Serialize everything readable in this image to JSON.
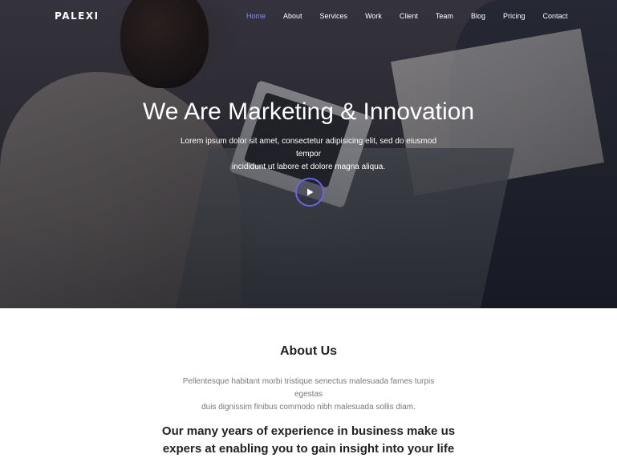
{
  "brand": {
    "logo": "PALEXI"
  },
  "nav": {
    "items": [
      {
        "label": "Home",
        "active": true
      },
      {
        "label": "About",
        "active": false
      },
      {
        "label": "Services",
        "active": false
      },
      {
        "label": "Work",
        "active": false
      },
      {
        "label": "Client",
        "active": false
      },
      {
        "label": "Team",
        "active": false
      },
      {
        "label": "Blog",
        "active": false
      },
      {
        "label": "Pricing",
        "active": false
      },
      {
        "label": "Contact",
        "active": false
      }
    ],
    "active_color": "#8b8cf5"
  },
  "hero": {
    "title": "We Are Marketing & Innovation",
    "subtitle_line1": "Lorem ipsum dolor sit amet, consectetur adipisicing elit, sed do eiusmod tempor",
    "subtitle_line2": "incididunt ut labore et dolore magna aliqua.",
    "play_icon": "play-icon",
    "accent_color": "#6b63e8"
  },
  "about": {
    "title": "About Us",
    "text_line1": "Pellentesque habitant morbi tristique senectus malesuada fames turpis egestas",
    "text_line2": "duis dignissim finibus commodo nibh malesuada sollis diam.",
    "headline_line1": "Our many years of experience in business make us",
    "headline_line2": "expers at enabling you to gain insight into your life"
  }
}
